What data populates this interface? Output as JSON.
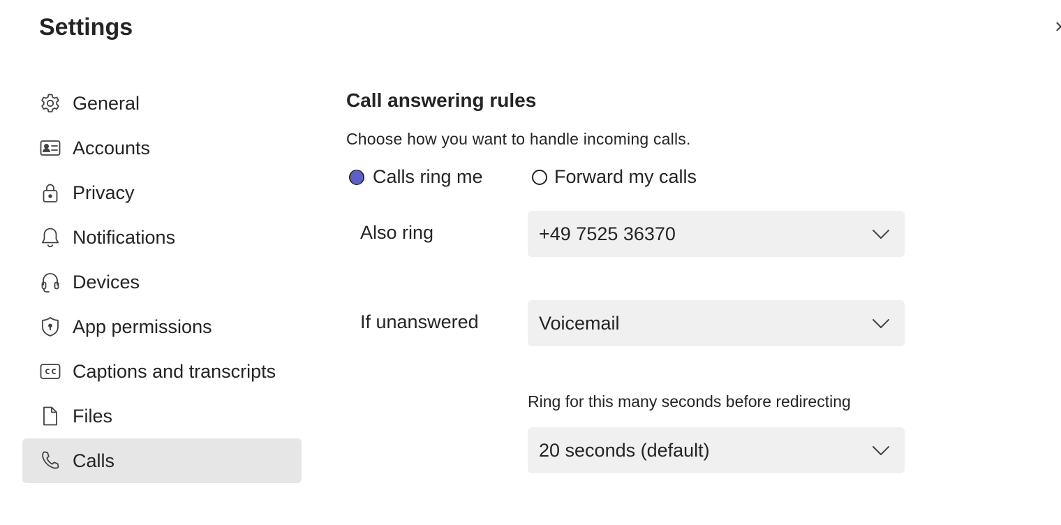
{
  "window": {
    "title": "Settings",
    "close_glyph": "×"
  },
  "sidebar": {
    "items": [
      {
        "label": "General",
        "icon": "gear-icon"
      },
      {
        "label": "Accounts",
        "icon": "id-card-icon"
      },
      {
        "label": "Privacy",
        "icon": "lock-icon"
      },
      {
        "label": "Notifications",
        "icon": "bell-icon"
      },
      {
        "label": "Devices",
        "icon": "headset-icon"
      },
      {
        "label": "App permissions",
        "icon": "shield-icon"
      },
      {
        "label": "Captions and transcripts",
        "icon": "closed-captions-icon"
      },
      {
        "label": "Files",
        "icon": "document-icon"
      },
      {
        "label": "Calls",
        "icon": "phone-icon",
        "active": true
      }
    ]
  },
  "calls": {
    "section_title": "Call answering rules",
    "description": "Choose how you want to handle incoming calls.",
    "radio_options": [
      {
        "label": "Calls ring me",
        "selected": true
      },
      {
        "label": "Forward my calls",
        "selected": false
      }
    ],
    "also_ring": {
      "label": "Also ring",
      "value": "+49 7525 36370"
    },
    "if_unanswered": {
      "label": "If unanswered",
      "value": "Voicemail"
    },
    "ring_duration": {
      "hint": "Ring for this many seconds before redirecting",
      "value": "20 seconds (default)"
    }
  },
  "colors": {
    "accent": "#5b5fc7",
    "active_nav_bg": "#e6e6e6",
    "dropdown_bg": "#f0f0f0"
  }
}
